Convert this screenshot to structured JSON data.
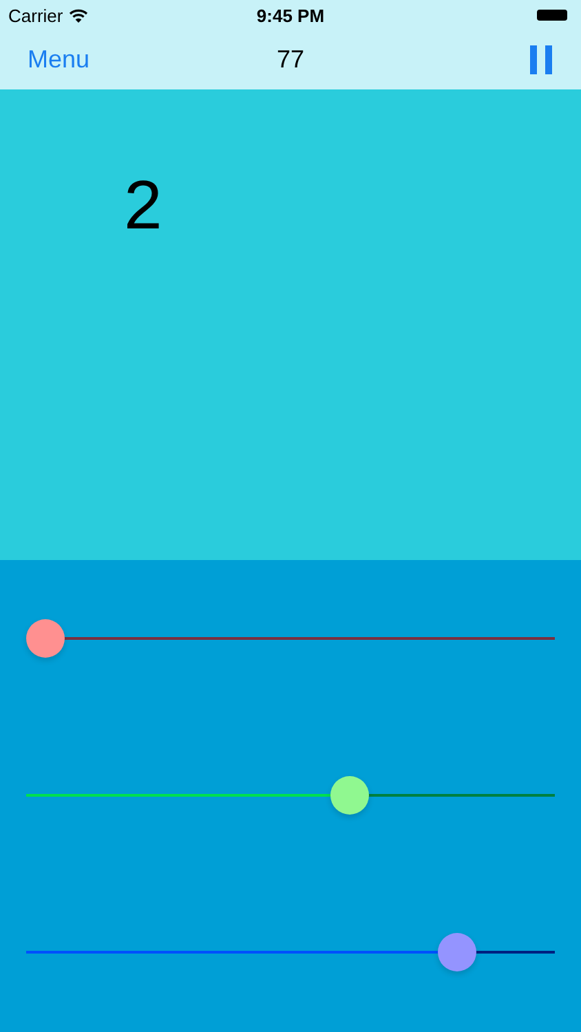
{
  "status_bar": {
    "carrier": "Carrier",
    "time": "9:45 PM"
  },
  "nav_bar": {
    "menu": "Menu",
    "score": "77"
  },
  "display": {
    "value": "2"
  },
  "sliders": [
    {
      "level": 0.0,
      "color": "#ff9090"
    },
    {
      "level": 0.62,
      "color": "#90f890"
    },
    {
      "level": 0.84,
      "color": "#9494ff"
    }
  ]
}
